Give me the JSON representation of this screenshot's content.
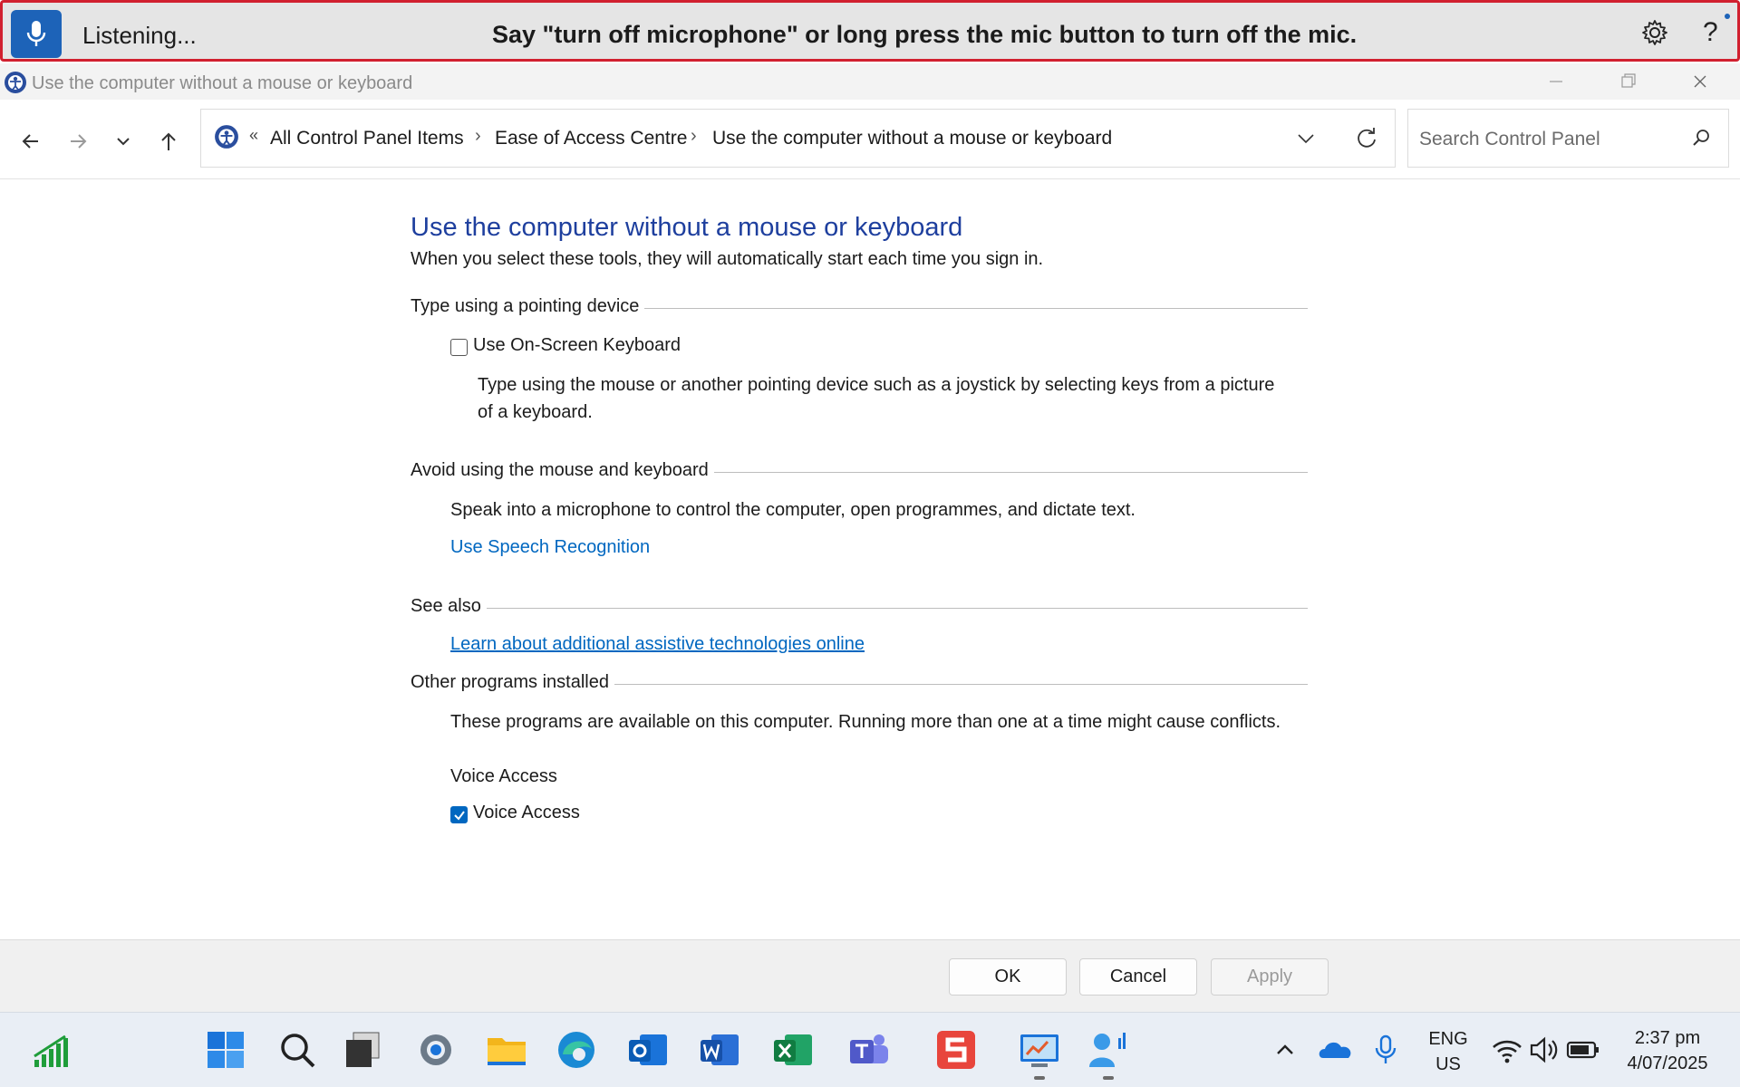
{
  "voice_access": {
    "status": "Listening...",
    "hint": "Say \"turn off microphone\" or long press the mic button to turn off the mic.",
    "help_glyph": "?"
  },
  "window": {
    "title": "Use the computer without a mouse or keyboard"
  },
  "address_bar": {
    "overflow_glyph": "«",
    "crumbs": [
      "All Control Panel Items",
      "Ease of Access Centre",
      "Use the computer without a mouse or keyboard"
    ],
    "separator": "›"
  },
  "search": {
    "placeholder": "Search Control Panel"
  },
  "content": {
    "title": "Use the computer without a mouse or keyboard",
    "subtitle": "When you select these tools, they will automatically start each time you sign in.",
    "section1": {
      "label": "Type using a pointing device",
      "checkbox_label": "Use On-Screen Keyboard",
      "checkbox_checked": false,
      "description_line1": "Type using the mouse or another pointing device such as a joystick by selecting keys from a picture",
      "description_line2": "of a keyboard."
    },
    "section2": {
      "label": "Avoid using the mouse and keyboard",
      "description": "Speak into a microphone to control the computer, open programmes, and dictate text.",
      "link": "Use Speech Recognition"
    },
    "section3": {
      "label": "See also",
      "link": "Learn about additional assistive technologies online"
    },
    "section4": {
      "label": "Other programs installed",
      "description": "These programs are available on this computer. Running more than one at a time might cause conflicts.",
      "group_label": "Voice Access",
      "checkbox_label": "Voice Access",
      "checkbox_checked": true
    }
  },
  "buttons": {
    "ok": "OK",
    "cancel": "Cancel",
    "apply": "Apply"
  },
  "taskbar": {
    "apps": [
      "stocks-widget",
      "start",
      "search",
      "task-view",
      "settings",
      "file-explorer",
      "edge",
      "outlook",
      "word",
      "excel",
      "teams",
      "snagit",
      "control-panel",
      "voice-access"
    ],
    "tray": {
      "lang_line1": "ENG",
      "lang_line2": "US",
      "time": "2:37 pm",
      "date": "4/07/2025"
    }
  },
  "colors": {
    "accent": "#0067c0",
    "heading": "#1e3f9e",
    "voice_border": "#d1202f",
    "mic_button": "#1d63b8"
  }
}
